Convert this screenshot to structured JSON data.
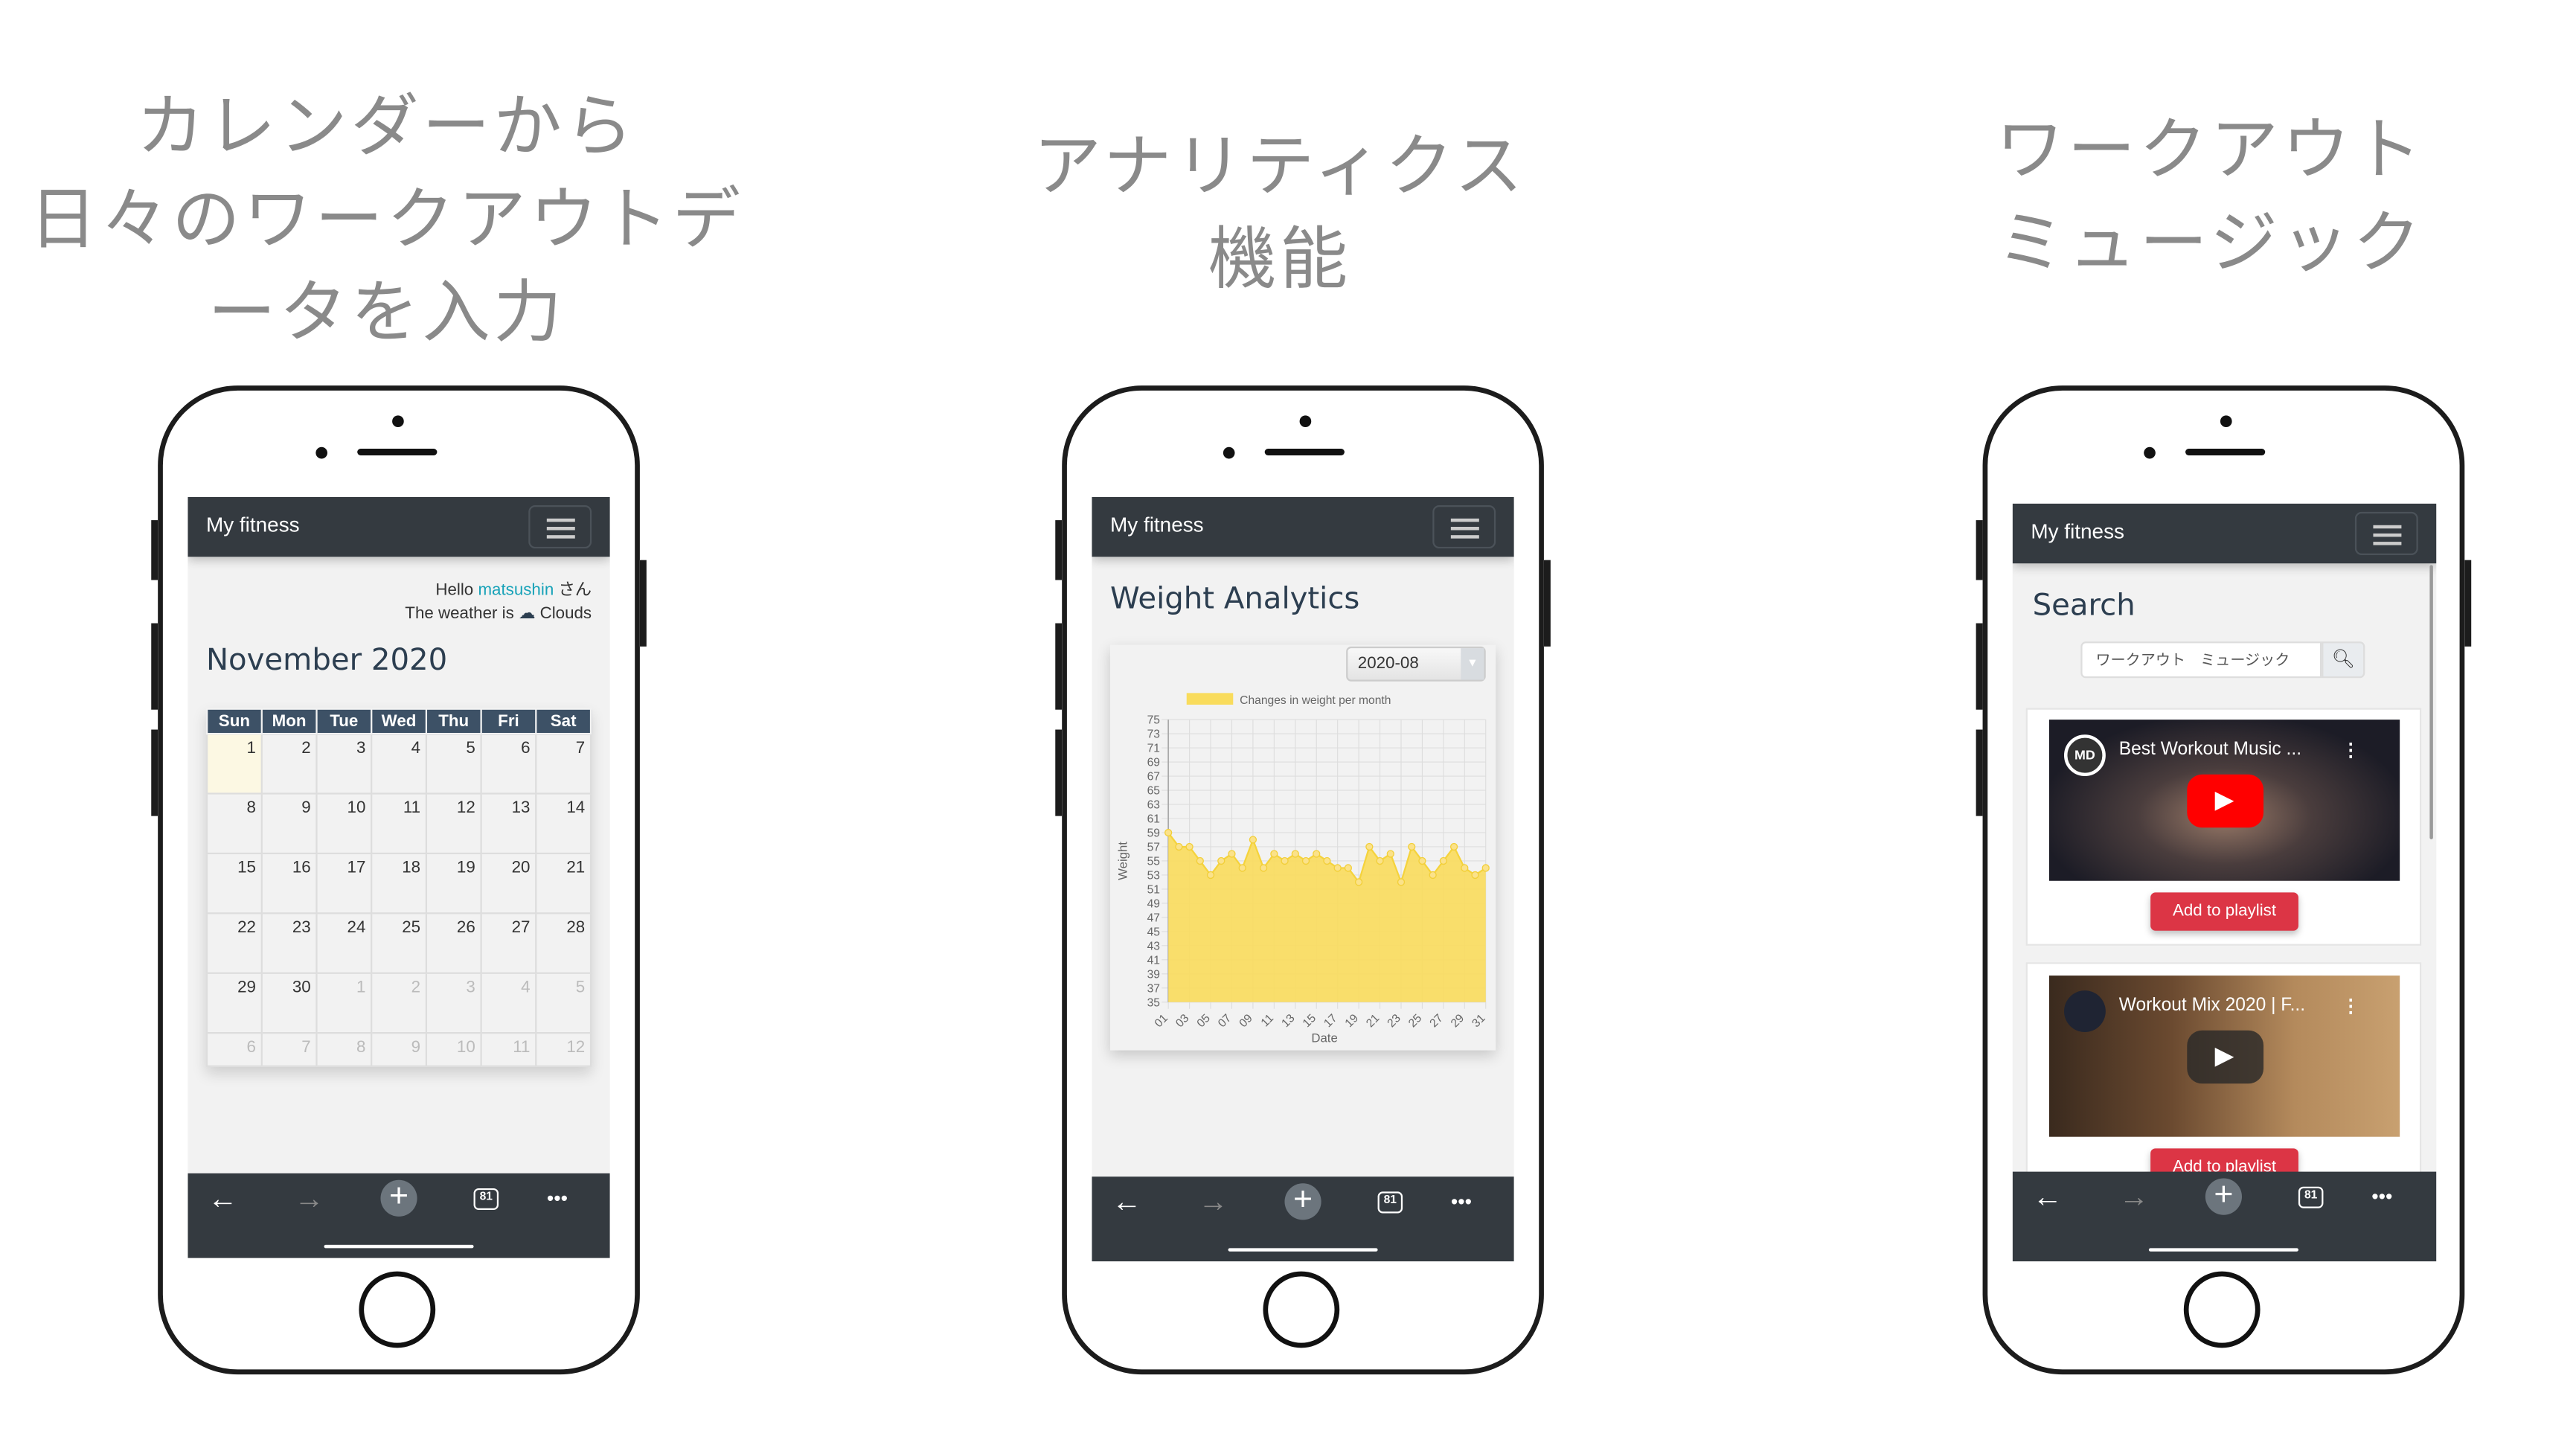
{
  "headings": {
    "calendar": [
      "カレンダーから",
      "日々のワークアウトデ",
      "ータを入力"
    ],
    "analytics": [
      "アナリティクス",
      "機能"
    ],
    "music": [
      "ワークアウト",
      "ミュージック"
    ]
  },
  "app": {
    "brand": "My fitness"
  },
  "toolbar": {
    "back": "←",
    "forward": "→",
    "new_tab": "+",
    "tab_count": "81",
    "more": "•••"
  },
  "calendar_screen": {
    "greeting_prefix": "Hello",
    "username": "matsushin",
    "greeting_suffix": "さん",
    "weather_prefix": "The weather is",
    "weather": "Clouds",
    "month_title": "November 2020",
    "weekdays": [
      "Sun",
      "Mon",
      "Tue",
      "Wed",
      "Thu",
      "Fri",
      "Sat"
    ],
    "weeks": [
      [
        "1",
        "2",
        "3",
        "4",
        "5",
        "6",
        "7"
      ],
      [
        "8",
        "9",
        "10",
        "11",
        "12",
        "13",
        "14"
      ],
      [
        "15",
        "16",
        "17",
        "18",
        "19",
        "20",
        "21"
      ],
      [
        "22",
        "23",
        "24",
        "25",
        "26",
        "27",
        "28"
      ],
      [
        "29",
        "30",
        "1",
        "2",
        "3",
        "4",
        "5"
      ],
      [
        "6",
        "7",
        "8",
        "9",
        "10",
        "11",
        "12"
      ]
    ],
    "today": "1"
  },
  "analytics_screen": {
    "title": "Weight Analytics",
    "month_select": "2020-08"
  },
  "chart_data": {
    "type": "area",
    "title": "",
    "legend": "Changes in weight per month",
    "legend_position": "top",
    "xlabel": "Date",
    "ylabel": "Weight",
    "ylim": [
      35,
      75
    ],
    "y_ticks": [
      35,
      37,
      39,
      41,
      43,
      45,
      47,
      49,
      51,
      53,
      55,
      57,
      59,
      61,
      63,
      65,
      67,
      69,
      71,
      73,
      75
    ],
    "x": [
      "01",
      "02",
      "03",
      "04",
      "05",
      "06",
      "07",
      "08",
      "09",
      "10",
      "11",
      "12",
      "13",
      "14",
      "15",
      "16",
      "17",
      "18",
      "19",
      "20",
      "21",
      "22",
      "23",
      "24",
      "25",
      "26",
      "27",
      "28",
      "29",
      "30",
      "31"
    ],
    "x_tick_labels": [
      "01",
      "03",
      "05",
      "07",
      "09",
      "11",
      "13",
      "15",
      "17",
      "19",
      "21",
      "23",
      "25",
      "27",
      "29",
      "31"
    ],
    "values": [
      59,
      57,
      57,
      55,
      53,
      55,
      56,
      54,
      58,
      54,
      56,
      55,
      56,
      55,
      56,
      55,
      54,
      54,
      52,
      57,
      55,
      56,
      52,
      57,
      55,
      53,
      55,
      57,
      54,
      53,
      54
    ],
    "color": "#f9dc5c",
    "grid": true
  },
  "music_screen": {
    "title": "Search",
    "search_value": "ワークアウト　ミュージック",
    "videos": [
      {
        "title": "Best Workout Music ...",
        "add_label": "Add to playlist"
      },
      {
        "title": "Workout Mix 2020 | F...",
        "add_label": "Add to playlist"
      }
    ]
  },
  "colors": {
    "navbar": "#343a40",
    "accent_link": "#17a2b8",
    "danger": "#dc3545",
    "heading": "#2c3e50",
    "calendar_header": "#3d5166"
  }
}
